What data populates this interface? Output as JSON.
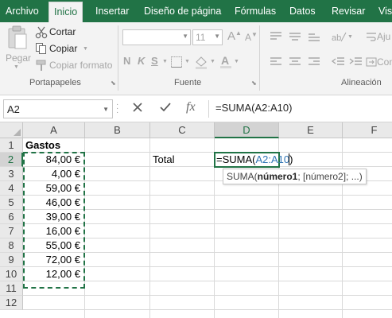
{
  "colors": {
    "accent": "#217346",
    "range_ref": "#2f75b5",
    "ribbon_bg": "#f3f3f3",
    "header_bg": "#e9e9e9"
  },
  "menu": {
    "tabs": [
      {
        "label": "Archivo"
      },
      {
        "label": "Inicio",
        "active": true
      },
      {
        "label": "Insertar"
      },
      {
        "label": "Diseño de página"
      },
      {
        "label": "Fórmulas"
      },
      {
        "label": "Datos"
      },
      {
        "label": "Revisar"
      },
      {
        "label": "Vis"
      }
    ]
  },
  "ribbon": {
    "clipboard": {
      "paste_label": "Pegar",
      "cut_label": "Cortar",
      "copy_label": "Copiar",
      "format_painter_label": "Copiar formato",
      "group_label": "Portapapeles",
      "icons": [
        "paste-icon",
        "scissors-icon",
        "copy-icon",
        "format-painter-icon"
      ]
    },
    "font": {
      "font_name": "",
      "font_size": "11",
      "grow_label": "A",
      "shrink_label": "A",
      "bold_label": "N",
      "italic_label": "K",
      "underline_label": "S",
      "group_label": "Fuente"
    },
    "alignment": {
      "wrap_label": "Aju",
      "merge_label": "Con",
      "group_label": "Alineación"
    }
  },
  "formula_bar": {
    "name_box": "A2",
    "formula": "=SUMA(A2:A10)",
    "cancel_icon": "cross-icon",
    "enter_icon": "check-icon",
    "fx_label": "fx"
  },
  "sheet": {
    "columns": [
      "A",
      "B",
      "C",
      "D",
      "E",
      "F"
    ],
    "selected_column": "D",
    "rows": [
      "1",
      "2",
      "3",
      "4",
      "5",
      "6",
      "7",
      "8",
      "9",
      "10",
      "11",
      "12"
    ],
    "selected_row": "2",
    "cells": {
      "A1": "Gastos",
      "A2": "84,00 €",
      "A3": "4,00 €",
      "A4": "59,00 €",
      "A5": "46,00 €",
      "A6": "39,00 €",
      "A7": "16,00 €",
      "A8": "55,00 €",
      "A9": "72,00 €",
      "A10": "12,00 €",
      "C2": "Total"
    },
    "editing": {
      "cell": "D2",
      "prefix": "=SUMA(",
      "range_ref": "A2:A10",
      "suffix": ")"
    },
    "tooltip": {
      "func": "SUMA(",
      "arg1": "número1",
      "rest": "; [número2]; ...)"
    }
  }
}
